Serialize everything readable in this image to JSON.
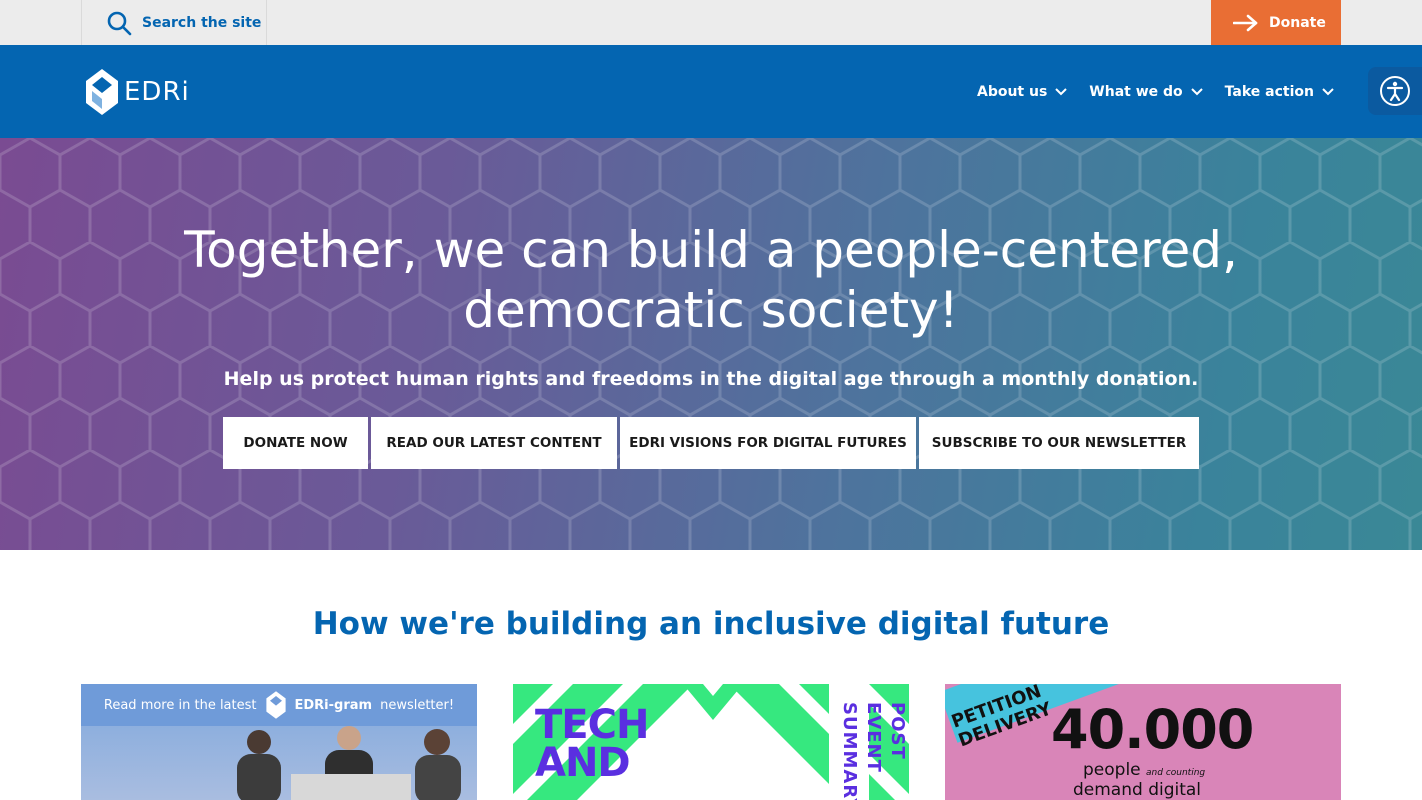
{
  "topbar": {
    "search_label": "Search the site",
    "donate_label": "Donate"
  },
  "logo": {
    "text": "EDRi"
  },
  "nav": {
    "items": [
      {
        "label": "About us"
      },
      {
        "label": "What we do"
      },
      {
        "label": "Take action"
      }
    ]
  },
  "hero": {
    "title": "Together, we can build a people-centered, democratic society!",
    "subtitle": "Help us protect human rights and freedoms in the digital age through a monthly donation.",
    "buttons": [
      {
        "label": "Donate now"
      },
      {
        "label": "Read our latest content"
      },
      {
        "label": "EDRi visions for digital futures"
      },
      {
        "label": "Subscribe to our newsletter"
      }
    ]
  },
  "section": {
    "title": "How we're building an inclusive digital future"
  },
  "cards": {
    "card1": {
      "prefix": "Read more in the latest",
      "brand": "EDRi-gram",
      "suffix": "newsletter!"
    },
    "card2": {
      "line1": "TECH",
      "line2": "AND",
      "side": "POST EVENT SUMMARY"
    },
    "card3": {
      "ribbon_line1": "PETITION",
      "ribbon_line2": "DELIVERY",
      "number": "40.000",
      "people": "people",
      "counting": "and counting",
      "line2": "demand digital"
    }
  },
  "colors": {
    "brand_blue": "#0465b1",
    "donate_orange": "#e96e34"
  },
  "icons": {
    "search": "search-icon",
    "arrow": "arrow-right-icon",
    "chevron": "chevron-down-icon",
    "accessibility": "accessibility-icon"
  }
}
